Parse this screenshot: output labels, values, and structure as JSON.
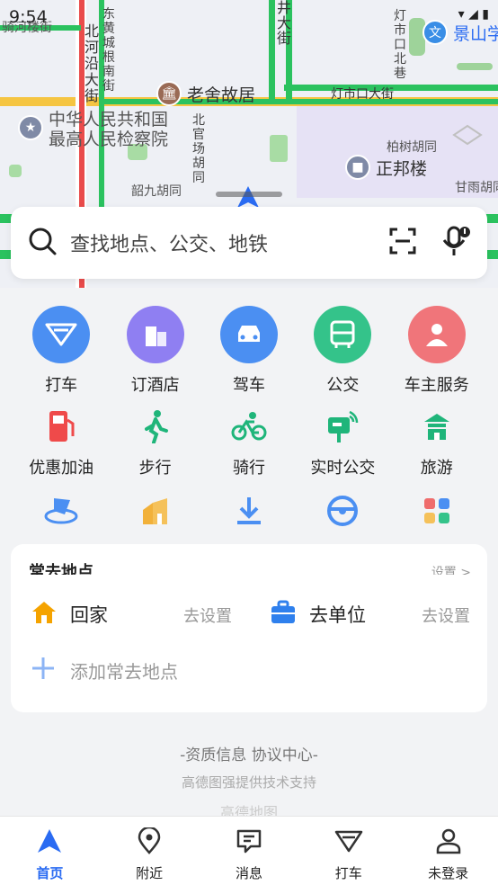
{
  "status": {
    "time": "9:54",
    "right": "▾ ◢ ▮"
  },
  "map": {
    "labels": {
      "qilou": "骑河楼街",
      "dongcheng": "东黄城根南街",
      "beihe": "北河沿大街",
      "jingda": "井大街",
      "dengshikou_xiang": "灯市口北巷",
      "dengshikou_street": "灯市口大街",
      "beiguan": "北官场胡同",
      "baishu": "柏树胡同",
      "shaojiu": "韶九胡同",
      "ganyu": "甘雨胡同"
    },
    "pois": {
      "laoshe": "老舍故居",
      "procuratorate_1": "中华人民共和国",
      "procuratorate_2": "最高人民检察院",
      "zhengbang": "正邦楼",
      "jingshan": "景山学"
    }
  },
  "search": {
    "placeholder": "查找地点、公交、地铁"
  },
  "services_row1": [
    {
      "label": "打车",
      "color": "#4b8ff2",
      "icon": "taxi-icon"
    },
    {
      "label": "订酒店",
      "color": "#8f7ff2",
      "icon": "hotel-icon"
    },
    {
      "label": "驾车",
      "color": "#4b8ff2",
      "icon": "car-icon"
    },
    {
      "label": "公交",
      "color": "#34c38a",
      "icon": "bus-icon"
    },
    {
      "label": "车主服务",
      "color": "#f0757a",
      "icon": "car-owner-icon"
    }
  ],
  "services_row2": [
    {
      "label": "优惠加油",
      "color": "#ef4a4a",
      "icon": "fuel-icon"
    },
    {
      "label": "步行",
      "color": "#1fb57a",
      "icon": "walk-icon"
    },
    {
      "label": "骑行",
      "color": "#1fb57a",
      "icon": "bike-icon"
    },
    {
      "label": "实时公交",
      "color": "#1fb57a",
      "icon": "realtime-bus-icon"
    },
    {
      "label": "旅游",
      "color": "#1fb57a",
      "icon": "travel-icon"
    }
  ],
  "frequent": {
    "title": "常去地点",
    "more": "设置 >",
    "home": "回家",
    "home_action": "去设置",
    "work": "去单位",
    "work_action": "去设置",
    "add": "添加常去地点"
  },
  "footer": {
    "links": "-资质信息 协议中心-",
    "sub": "高德图强提供技术支持",
    "logo": "高德地图"
  },
  "tabs": [
    {
      "label": "首页",
      "active": true
    },
    {
      "label": "附近"
    },
    {
      "label": "消息"
    },
    {
      "label": "打车"
    },
    {
      "label": "未登录"
    }
  ],
  "colors": {
    "accent": "#2a6bf2",
    "road_green": "#2bc25f",
    "road_red": "#e94b4b",
    "road_yellow": "#f5c542"
  }
}
